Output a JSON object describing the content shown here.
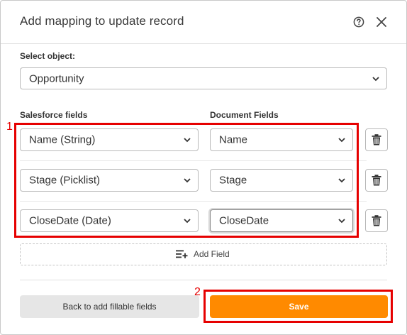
{
  "dialog": {
    "title": "Add mapping to update record",
    "help_icon": "question-circle-icon",
    "close_icon": "close-x-icon"
  },
  "object": {
    "label": "Select object:",
    "selected": "Opportunity"
  },
  "columns": {
    "salesforce": "Salesforce fields",
    "document": "Document Fields"
  },
  "mappings": [
    {
      "salesforce_field": "Name (String)",
      "document_field": "Name"
    },
    {
      "salesforce_field": "Stage (Picklist)",
      "document_field": "Stage"
    },
    {
      "salesforce_field": "CloseDate (Date)",
      "document_field": "CloseDate"
    }
  ],
  "add_field_label": "Add Field",
  "footer": {
    "back_label": "Back to add fillable fields",
    "save_label": "Save"
  },
  "annotations": [
    "1",
    "2"
  ],
  "colors": {
    "accent": "#ff8a00",
    "annotation": "#e60000",
    "back_button": "#e6e6e6"
  }
}
